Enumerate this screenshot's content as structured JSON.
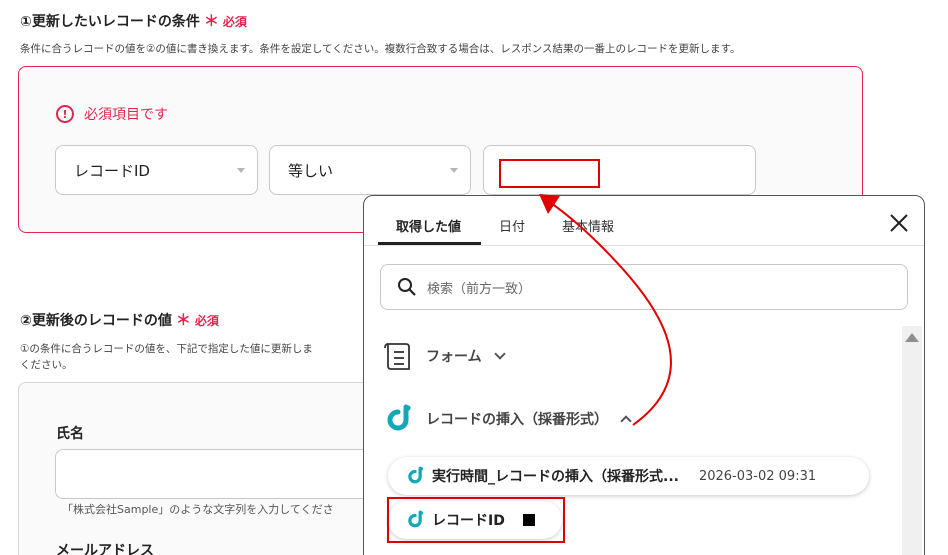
{
  "section1": {
    "title": "①更新したいレコードの条件",
    "required_mark": "＊",
    "required_label": "必須",
    "description": "条件に合うレコードの値を②の値に書き換えます。条件を設定してください。複数行合致する場合は、レスポンス結果の一番上のレコードを更新します。",
    "error_icon": "!",
    "error_text": "必須項目です",
    "field_select": "レコードID",
    "operator_select": "等しい",
    "value_input": ""
  },
  "section2": {
    "title": "②更新後のレコードの値",
    "required_mark": "＊",
    "required_label": "必須",
    "description_line1": "①の条件に合うレコードの値を、下記で指定した値に更新しま",
    "description_line2": "ください。",
    "name_label": "氏名",
    "name_value": "",
    "name_hint": "「株式会社Sample」のような文字列を入力してくださ",
    "email_label": "メールアドレス"
  },
  "picker": {
    "tabs": [
      "取得した値",
      "日付",
      "基本情報"
    ],
    "active_tab": "取得した値",
    "search_placeholder": "検索（前方一致）",
    "groups": [
      {
        "label": "フォーム",
        "expanded": false,
        "icon": "form-icon"
      },
      {
        "label": "レコードの挿入（採番形式）",
        "expanded": true,
        "icon": "database-app-icon"
      }
    ],
    "items": [
      {
        "label": "実行時間_レコードの挿入（採番形式...",
        "value": "2026-03-02 09:31"
      },
      {
        "label": "レコードID",
        "value": ""
      }
    ]
  },
  "colors": {
    "error": "#e0284f",
    "annotation": "#e00000",
    "brand": "#14a7b8"
  }
}
